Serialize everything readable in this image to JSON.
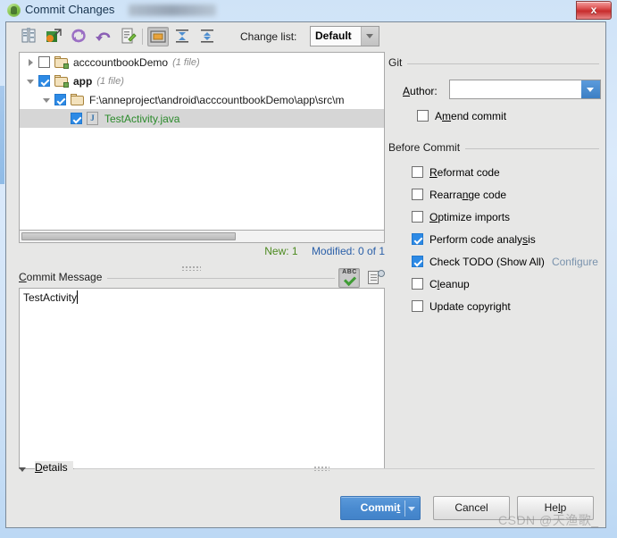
{
  "window": {
    "title": "Commit Changes",
    "title_icon": "android-studio-icon",
    "blurred_project_name": "",
    "close_label": "x",
    "accent_blue": "#4a8bd0",
    "link_color": "#7a93ad"
  },
  "toolbar": {
    "changelist_label": "Change list:",
    "changelist_value": "Default",
    "buttons": [
      {
        "name": "show-diff-icon",
        "pressed": false
      },
      {
        "name": "move-to-changelist-icon",
        "pressed": false
      },
      {
        "name": "refresh-icon",
        "pressed": false
      },
      {
        "name": "revert-icon",
        "pressed": false
      },
      {
        "name": "edit-source-icon",
        "pressed": false
      },
      {
        "name": "group-by-directory-icon",
        "pressed": true
      },
      {
        "name": "expand-all-icon",
        "pressed": false
      },
      {
        "name": "collapse-all-icon",
        "pressed": false
      }
    ]
  },
  "tree": {
    "rows": [
      {
        "name": "acccountbookDemo",
        "meta": "(1 file)",
        "checked": false,
        "expanded": false,
        "indent": 0,
        "icon": "module-folder-icon",
        "selected": false,
        "green": false
      },
      {
        "name": "app",
        "meta": "(1 file)",
        "checked": true,
        "expanded": true,
        "indent": 0,
        "icon": "module-folder-icon",
        "selected": false,
        "green": false
      },
      {
        "name": "F:\\anneproject\\android\\acccountbookDemo\\app\\src\\m",
        "meta": "",
        "checked": true,
        "expanded": true,
        "indent": 1,
        "icon": "folder-icon",
        "selected": false,
        "green": false
      },
      {
        "name": "TestActivity.java",
        "meta": "",
        "checked": true,
        "expanded": null,
        "indent": 2,
        "icon": "java-file-icon",
        "selected": true,
        "green": true
      }
    ],
    "counts": {
      "new": "New: 1",
      "modified": "Modified: 0 of 1"
    }
  },
  "commit_message": {
    "label": "Commit Message",
    "label_mnemonic": "C",
    "value": "TestActivity",
    "placeholder": "",
    "spellcheck_icon": "spellcheck-abc-icon",
    "spellcheck_text": "ABC",
    "history_icon": "message-history-icon"
  },
  "git_group": {
    "title": "Git",
    "author_label": "Author:",
    "author_mnemonic": "A",
    "author_value": "",
    "author_placeholder": "",
    "author_dropdown_icon": "chevron-down-icon",
    "amend_commit": {
      "label": "Amend commit",
      "mnemonic": "m",
      "checked": false
    }
  },
  "before_commit_group": {
    "title": "Before Commit",
    "items": [
      {
        "label": "Reformat code",
        "mnemonic": "R",
        "checked": false,
        "link": ""
      },
      {
        "label": "Rearrange code",
        "mnemonic": "n",
        "checked": false,
        "link": ""
      },
      {
        "label": "Optimize imports",
        "mnemonic": "O",
        "checked": false,
        "link": ""
      },
      {
        "label": "Perform code analysis",
        "mnemonic": "s",
        "checked": true,
        "link": ""
      },
      {
        "label": "Check TODO (Show All)",
        "mnemonic": "",
        "checked": true,
        "link": "Configure"
      },
      {
        "label": "Cleanup",
        "mnemonic": "l",
        "checked": false,
        "link": ""
      },
      {
        "label": "Update copyright",
        "mnemonic": "",
        "checked": false,
        "link": ""
      }
    ]
  },
  "details": {
    "label": "Details",
    "expanded": true
  },
  "buttons": {
    "commit": "Commit",
    "commit_mnemonic": "t",
    "cancel": "Cancel",
    "help": "Help"
  },
  "watermark": "CSDN @天渔歌_"
}
